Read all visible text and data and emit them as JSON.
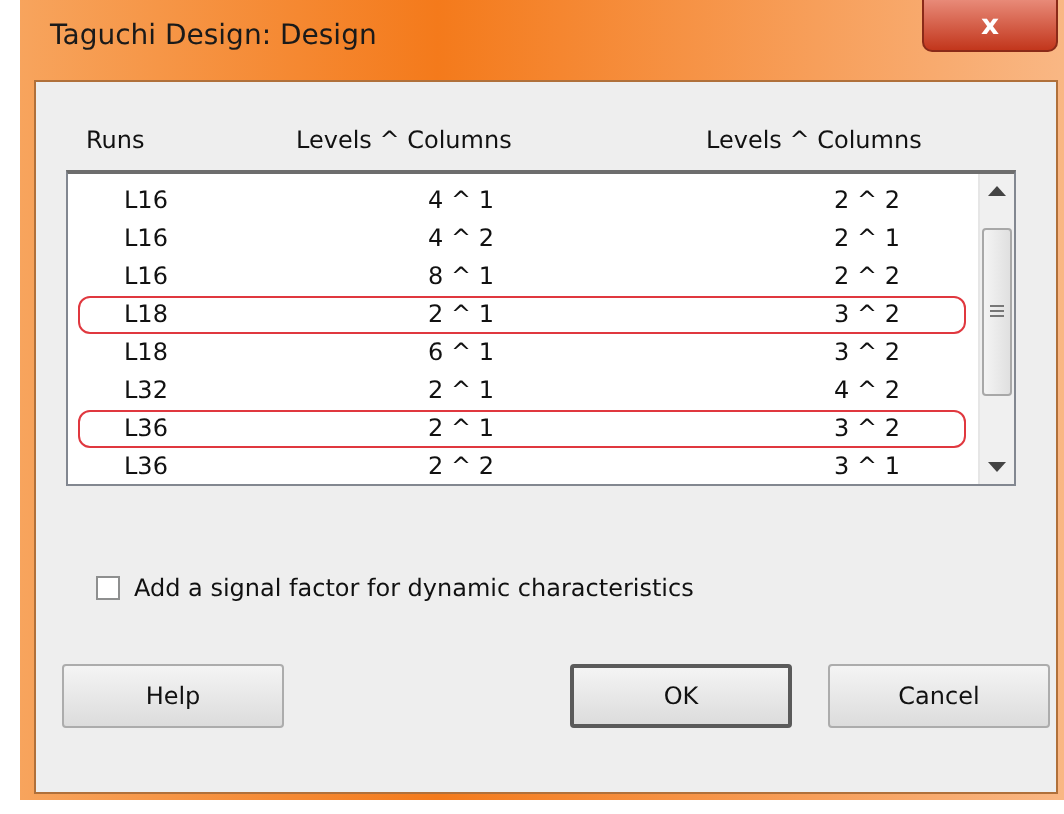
{
  "window": {
    "title": "Taguchi Design: Design",
    "close": "x"
  },
  "table": {
    "columns": [
      "Runs",
      "Levels ^ Columns",
      "Levels ^ Columns"
    ],
    "rows": [
      {
        "runs": "L16",
        "levels_1": "4 ^  1",
        "levels_2": "2 ^  2",
        "highlighted": false
      },
      {
        "runs": "L16",
        "levels_1": "4 ^  2",
        "levels_2": "2 ^  1",
        "highlighted": false
      },
      {
        "runs": "L16",
        "levels_1": "8 ^  1",
        "levels_2": "2 ^  2",
        "highlighted": false
      },
      {
        "runs": "L18",
        "levels_1": "2 ^  1",
        "levels_2": "3 ^  2",
        "highlighted": true
      },
      {
        "runs": "L18",
        "levels_1": "6 ^  1",
        "levels_2": "3 ^  2",
        "highlighted": false
      },
      {
        "runs": "L32",
        "levels_1": "2 ^  1",
        "levels_2": "4 ^  2",
        "highlighted": false
      },
      {
        "runs": "L36",
        "levels_1": "2 ^  1",
        "levels_2": "3 ^  2",
        "highlighted": true
      },
      {
        "runs": "L36",
        "levels_1": "2 ^  2",
        "levels_2": "3 ^  1",
        "highlighted": false
      }
    ]
  },
  "checkbox": {
    "label": "Add a signal factor for dynamic characteristics",
    "checked": false
  },
  "buttons": [
    {
      "label": "Help",
      "default": false
    },
    {
      "label": "OK",
      "default": true
    },
    {
      "label": "Cancel",
      "default": false
    }
  ]
}
